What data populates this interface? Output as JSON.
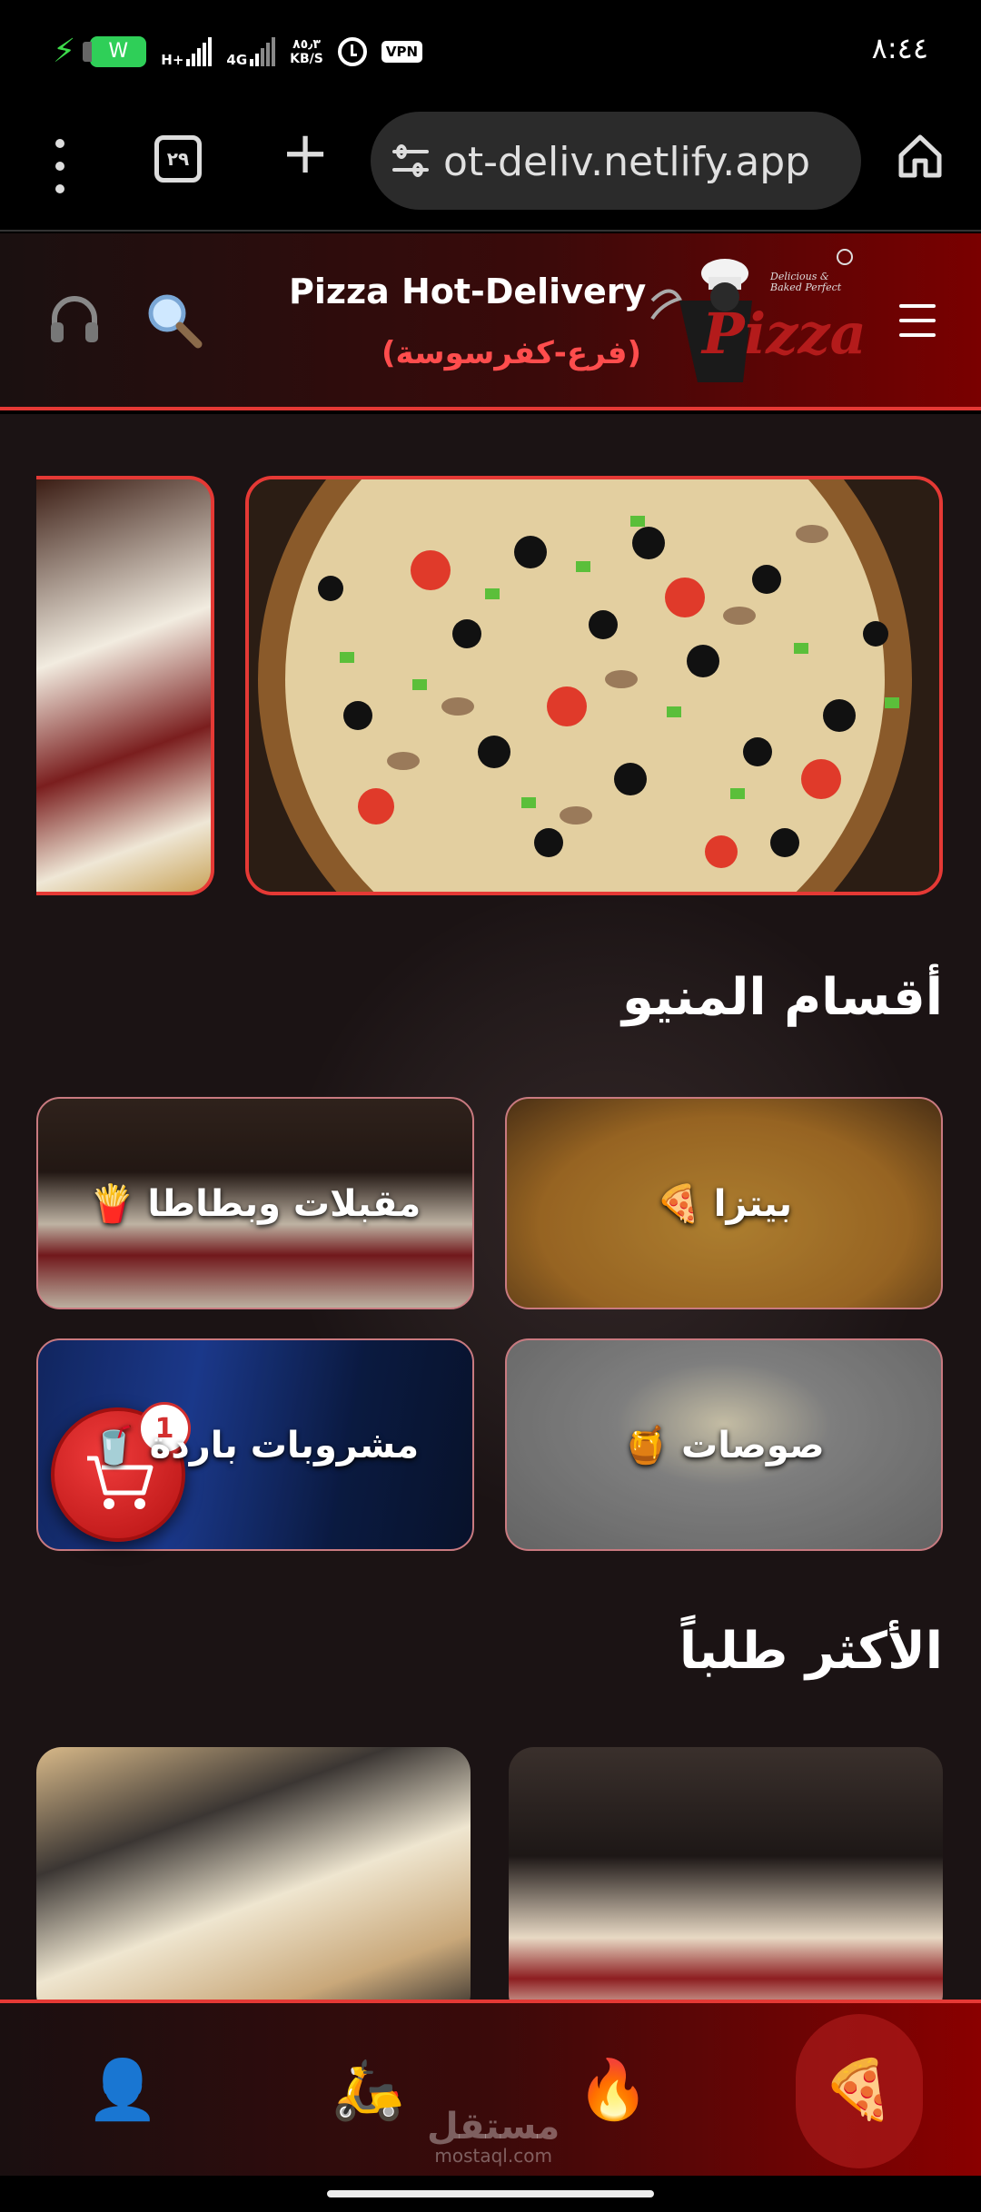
{
  "status_bar": {
    "battery": "W",
    "net_type_1": "H+",
    "net_type_2": "4G",
    "speed_value": "٨٥٫٣",
    "speed_unit": "KB/S",
    "vpn": "VPN",
    "time": "٨:٤٤"
  },
  "browser": {
    "tab_count": "٢٩",
    "url": "ot-deliv.netlify.app"
  },
  "header": {
    "title": "Pizza Hot-Delivery",
    "branch": "(فرع-كفرسوسة)",
    "logo_text": "Pizza",
    "logo_small": "Delicious & Baked Perfect"
  },
  "sections": {
    "menu_title": "أقسام المنيو",
    "popular_title": "الأكثر طلباً"
  },
  "categories": [
    {
      "label": "بيتزا 🍕"
    },
    {
      "label": "مقبلات وبطاطا 🍟"
    },
    {
      "label": "صوصات 🍯"
    },
    {
      "label": "مشروبات باردة 🥤"
    }
  ],
  "cart": {
    "count": "1"
  },
  "bottom_nav": {
    "items": [
      {
        "icon": "👤",
        "name": "profile"
      },
      {
        "icon": "🛵",
        "name": "delivery"
      },
      {
        "icon": "🔥",
        "name": "hot"
      },
      {
        "icon": "🍕",
        "name": "menu"
      }
    ],
    "watermark_ar": "مستقل",
    "watermark_en": "mostaql.com"
  },
  "colors": {
    "accent": "#e53935",
    "header_dark": "#1a1010",
    "header_red": "#7a0000",
    "page_bg": "#1b1314"
  }
}
